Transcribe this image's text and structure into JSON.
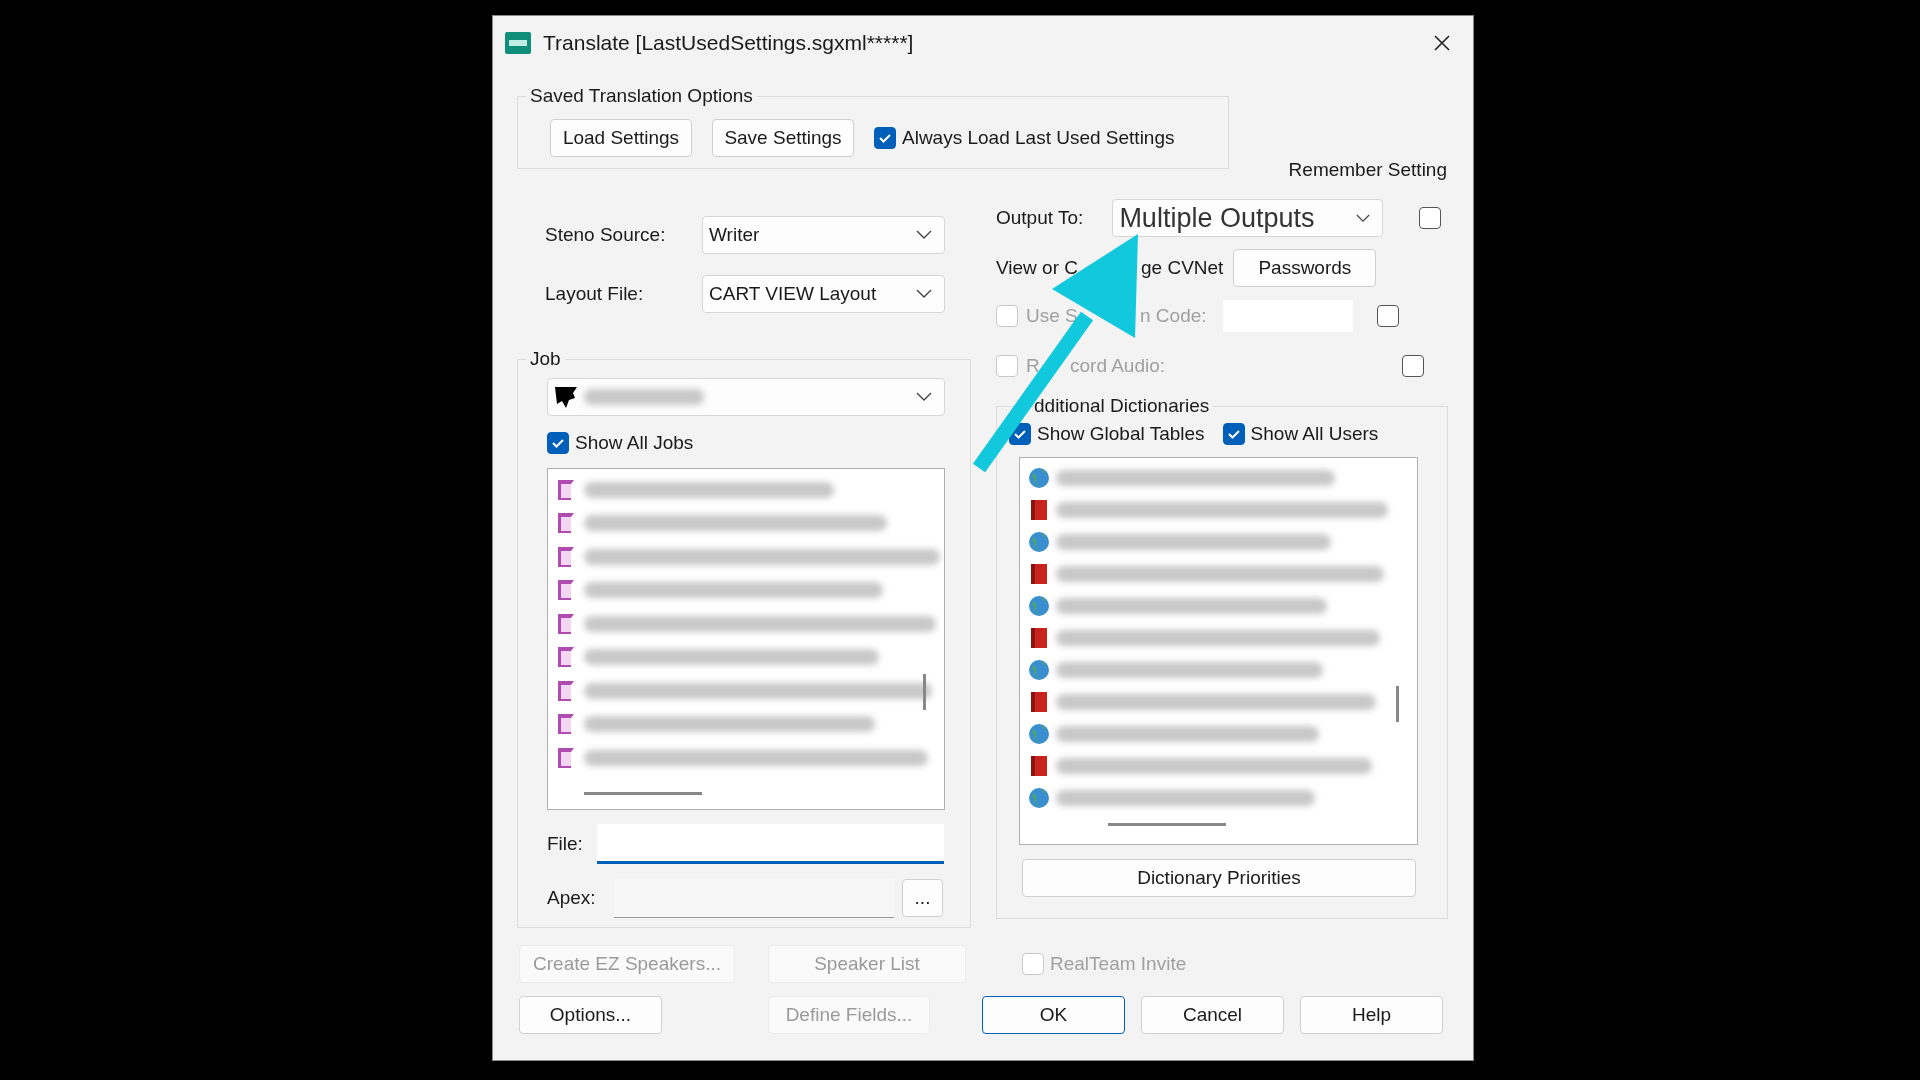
{
  "window": {
    "title": "Translate [LastUsedSettings.sgxml*****]"
  },
  "saved_options": {
    "title": "Saved Translation Options",
    "buttons": [
      "Load Settings",
      "Save Settings"
    ],
    "always_load": {
      "label": "Always Load Last Used Settings",
      "checked": true
    }
  },
  "remember_setting_label": "Remember Setting",
  "steno_source": {
    "label": "Steno Source:",
    "value": "Writer"
  },
  "layout_file": {
    "label": "Layout File:",
    "value": "CART VIEW Layout"
  },
  "job": {
    "title": "Job",
    "show_all_jobs": {
      "label": "Show All Jobs",
      "checked": true
    },
    "items": [
      {
        "kind": "job"
      },
      {
        "kind": "job"
      },
      {
        "kind": "job"
      },
      {
        "kind": "job"
      },
      {
        "kind": "job"
      },
      {
        "kind": "job"
      },
      {
        "kind": "job"
      },
      {
        "kind": "job"
      },
      {
        "kind": "job"
      }
    ]
  },
  "file": {
    "label": "File:",
    "focused": true
  },
  "apex": {
    "label": "Apex:",
    "button": "..."
  },
  "output": {
    "label": "Output To:",
    "value": "Multiple Outputs",
    "remember": false
  },
  "cvnet": {
    "label_parts": [
      "View or C",
      "ge CVNet"
    ],
    "button": "Passwords"
  },
  "system_code": {
    "label_parts": [
      "Use S",
      "n Code:"
    ],
    "checked": false,
    "disabled": true,
    "remember": false
  },
  "record_audio": {
    "label_parts": [
      "R",
      "cord Audio:"
    ],
    "checked": false,
    "disabled": true,
    "remember": false
  },
  "dictionaries": {
    "title": "dditional Dictionaries",
    "show_global": {
      "label": "Show Global Tables",
      "checked": true
    },
    "show_all_users": {
      "label": "Show All Users",
      "checked": true
    },
    "items": [
      {
        "kind": "globe"
      },
      {
        "kind": "book"
      },
      {
        "kind": "globe"
      },
      {
        "kind": "book"
      },
      {
        "kind": "globe"
      },
      {
        "kind": "book"
      },
      {
        "kind": "globe"
      },
      {
        "kind": "book"
      },
      {
        "kind": "globe"
      },
      {
        "kind": "book"
      },
      {
        "kind": "globe"
      }
    ],
    "button": "Dictionary Priorities"
  },
  "speaker_buttons": [
    {
      "label": "Create EZ Speakers...",
      "disabled": true
    },
    {
      "label": "Speaker List",
      "disabled": true
    }
  ],
  "realteam": {
    "label": "RealTeam Invite",
    "checked": false,
    "disabled": true
  },
  "left_buttons": [
    {
      "label": "Options...",
      "disabled": false
    },
    {
      "label": "Define Fields...",
      "disabled": true
    }
  ],
  "actions": [
    {
      "label": "OK",
      "default": true
    },
    {
      "label": "Cancel",
      "default": false
    },
    {
      "label": "Help",
      "default": false
    }
  ]
}
